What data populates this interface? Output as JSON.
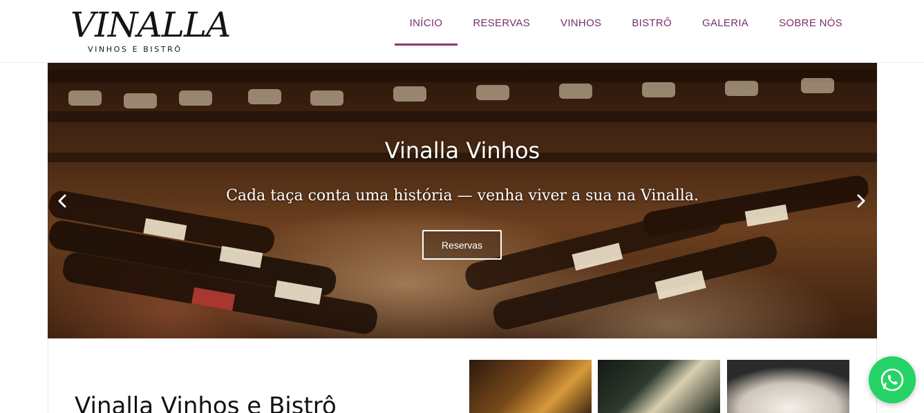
{
  "header": {
    "logo": {
      "name": "VINALLA",
      "tagline": "VINHOS E BISTRÔ"
    },
    "nav": [
      {
        "label": "INÍCIO",
        "active": true
      },
      {
        "label": "RESERVAS",
        "active": false
      },
      {
        "label": "VINHOS",
        "active": false
      },
      {
        "label": "BISTRÔ",
        "active": false
      },
      {
        "label": "GALERIA",
        "active": false
      },
      {
        "label": "SOBRE NÓS",
        "active": false
      }
    ]
  },
  "hero": {
    "title": "Vinalla Vinhos",
    "subtitle": "Cada taça conta uma história — venha viver a sua na Vinalla.",
    "button_label": "Reservas",
    "prev_icon": "chevron-left-icon",
    "next_icon": "chevron-right-icon"
  },
  "section": {
    "title": "Vinalla Vinhos e Bistrô"
  },
  "colors": {
    "brand": "#7a2e6a",
    "accent": "#8a3574",
    "whatsapp": "#25d366"
  },
  "whatsapp": {
    "icon": "whatsapp-icon"
  }
}
